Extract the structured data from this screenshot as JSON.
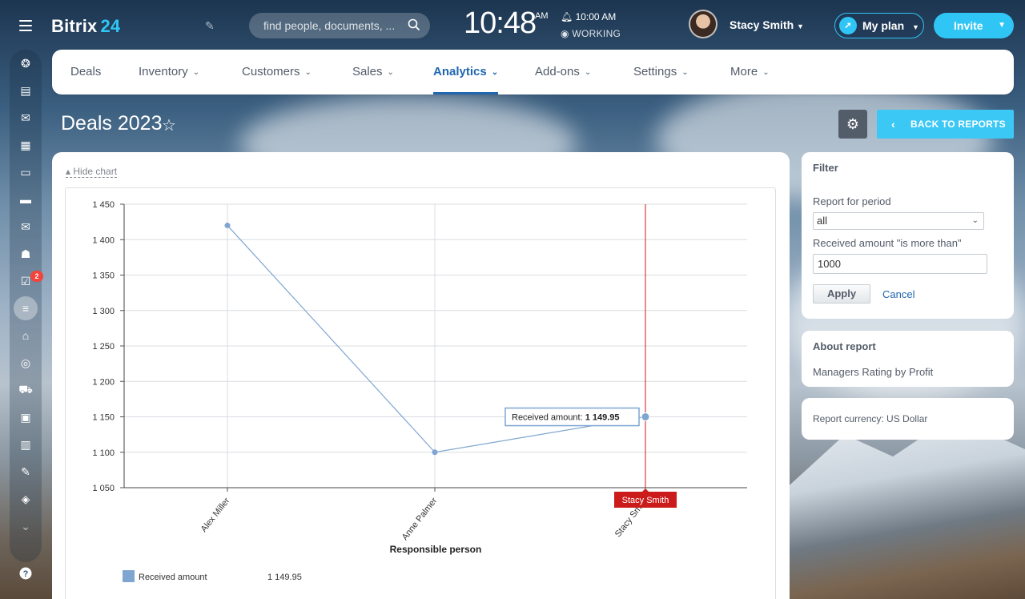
{
  "app": {
    "brand": "Bitrix",
    "brand_num": "24"
  },
  "header": {
    "search_placeholder": "find people, documents, ...",
    "clock": "10:48",
    "clock_ampm": "AM",
    "alarm": "10:00 AM",
    "work_status": "WORKING",
    "user_name": "Stacy Smith",
    "plan_label": "My plan",
    "invite_label": "Invite"
  },
  "sidebar": {
    "icons": [
      "activity-stream-icon",
      "feed-icon",
      "chat-icon",
      "calendar-icon",
      "documents-icon",
      "drive-icon",
      "mail-icon",
      "groups-icon",
      "tasks-icon",
      "crm-icon",
      "sites-icon",
      "marketing-icon",
      "shop-icon",
      "contact-center-icon",
      "robots-icon",
      "sign-icon",
      "inventory-icon",
      "more-icon"
    ],
    "tasks_badge": "2",
    "help_icon": "help-icon"
  },
  "nav": {
    "items": [
      {
        "label": "Deals",
        "chevron": false
      },
      {
        "label": "Inventory",
        "chevron": true
      },
      {
        "label": "Customers",
        "chevron": true
      },
      {
        "label": "Sales",
        "chevron": true
      },
      {
        "label": "Analytics",
        "chevron": true,
        "active": true
      },
      {
        "label": "Add-ons",
        "chevron": true
      },
      {
        "label": "Settings",
        "chevron": true
      },
      {
        "label": "More",
        "chevron": true
      }
    ]
  },
  "page": {
    "title": "Deals 2023",
    "back_label": "BACK TO REPORTS",
    "hide_chart": "Hide chart"
  },
  "filter": {
    "title": "Filter",
    "period_label": "Report for period",
    "period_value": "all",
    "amount_label": "Received amount \"is more than\"",
    "amount_value": "1000",
    "apply_label": "Apply",
    "cancel_label": "Cancel"
  },
  "about": {
    "title": "About report",
    "description": "Managers Rating by Profit"
  },
  "currency": {
    "text": "Report currency: US Dollar"
  },
  "chart_data": {
    "type": "line",
    "categories": [
      "Alex Miller",
      "Anne Palmer",
      "Stacy Smith"
    ],
    "series": [
      {
        "name": "Received amount",
        "values": [
          1420,
          1100,
          1149.95
        ],
        "color": "#7fa6d1"
      }
    ],
    "xlabel": "Responsible person",
    "ylabel": "",
    "ylim": [
      1050,
      1450
    ],
    "yticks": [
      1050,
      1100,
      1150,
      1200,
      1250,
      1300,
      1350,
      1400,
      1450
    ],
    "ytick_labels": [
      "1 050",
      "1 100",
      "1 150",
      "1 200",
      "1 250",
      "1 300",
      "1 350",
      "1 400",
      "1 450"
    ],
    "grid": true,
    "tooltip": {
      "label": "Received amount:",
      "value": "1 149.95",
      "category": "Stacy Smith"
    },
    "legend": {
      "name": "Received amount",
      "value": "1 149.95",
      "position": "bottom-left"
    },
    "cursor_color": "#cc1b1b"
  }
}
